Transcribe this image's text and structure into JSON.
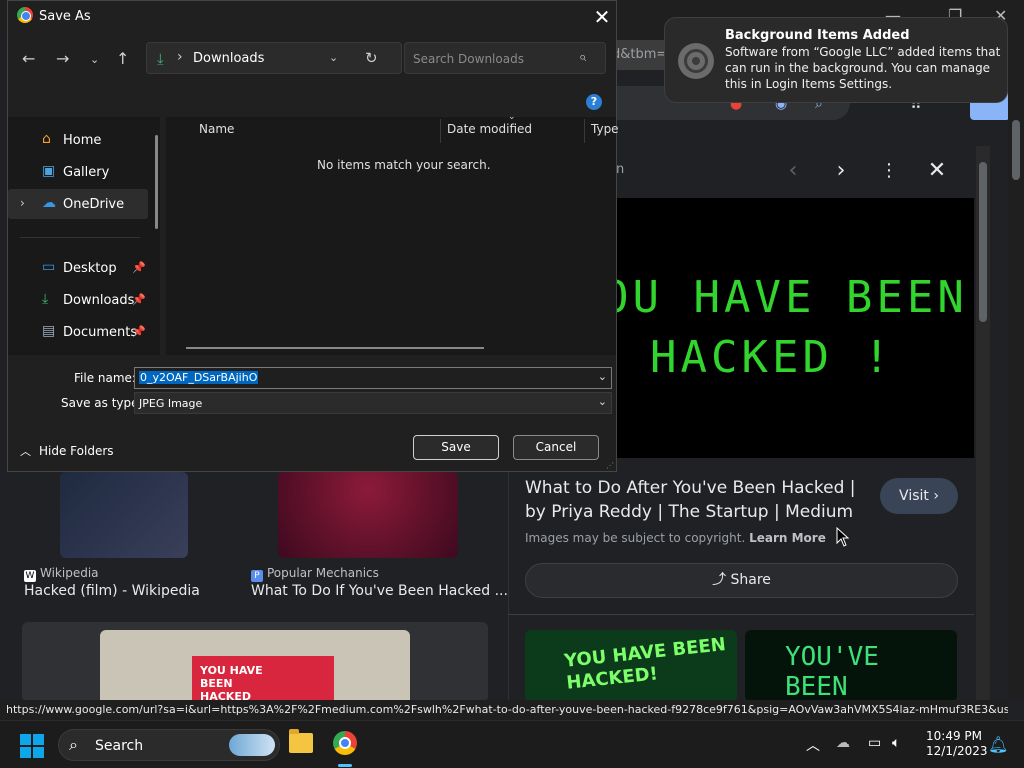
{
  "browser": {
    "url_fragment": "d&tbm=",
    "panel": {
      "title_partial": "n",
      "image_text_line1": "OU HAVE BEEN",
      "image_text_line2": "HACKED !",
      "result_title": "What to Do After You've Been Hacked | by Priya Reddy | The Startup | Medium",
      "visit_label": "Visit",
      "copyright_text": "Images may be subject to copyright.",
      "learn_more": "Learn More",
      "share_label": "Share",
      "thumb1_text": "YOU HAVE BEEN HACKED!",
      "thumb2_text": "YOU'VE BEEN"
    },
    "results": [
      {
        "source": "Wikipedia",
        "title": "Hacked (film) - Wikipedia"
      },
      {
        "source": "Popular Mechanics",
        "title": "What To Do If You've Been Hacked ..."
      }
    ],
    "thumb_bottom_text": "YOU HAVE BEEN HACKED",
    "status_url": "https://www.google.com/url?sa=i&url=https%3A%2F%2Fmedium.com%2Fswlh%2Fwhat-to-do-after-youve-been-hacked-f9278ce9f761&psig=AOvVaw3ahVMX5S4laz-mHmuf3RE3&us..."
  },
  "dialog": {
    "title": "Save As",
    "address": "Downloads",
    "search_placeholder": "Search Downloads",
    "sidebar": [
      {
        "label": "Home"
      },
      {
        "label": "Gallery"
      },
      {
        "label": "OneDrive"
      },
      {
        "label": "Desktop"
      },
      {
        "label": "Downloads"
      },
      {
        "label": "Documents"
      }
    ],
    "columns": [
      "Name",
      "Date modified",
      "Type"
    ],
    "empty_message": "No items match your search.",
    "file_name_label": "File name:",
    "file_name_value": "0_y2OAF_DSarBAjihO",
    "save_type_label": "Save as type:",
    "save_type_value": "JPEG Image",
    "hide_folders_label": "Hide Folders",
    "save_label": "Save",
    "cancel_label": "Cancel"
  },
  "notification": {
    "title": "Background Items Added",
    "body": "Software from “Google LLC” added items that can run in the background. You can manage this in Login Items Settings."
  },
  "taskbar": {
    "search_label": "Search",
    "time": "10:49 PM",
    "date": "12/1/2023"
  }
}
